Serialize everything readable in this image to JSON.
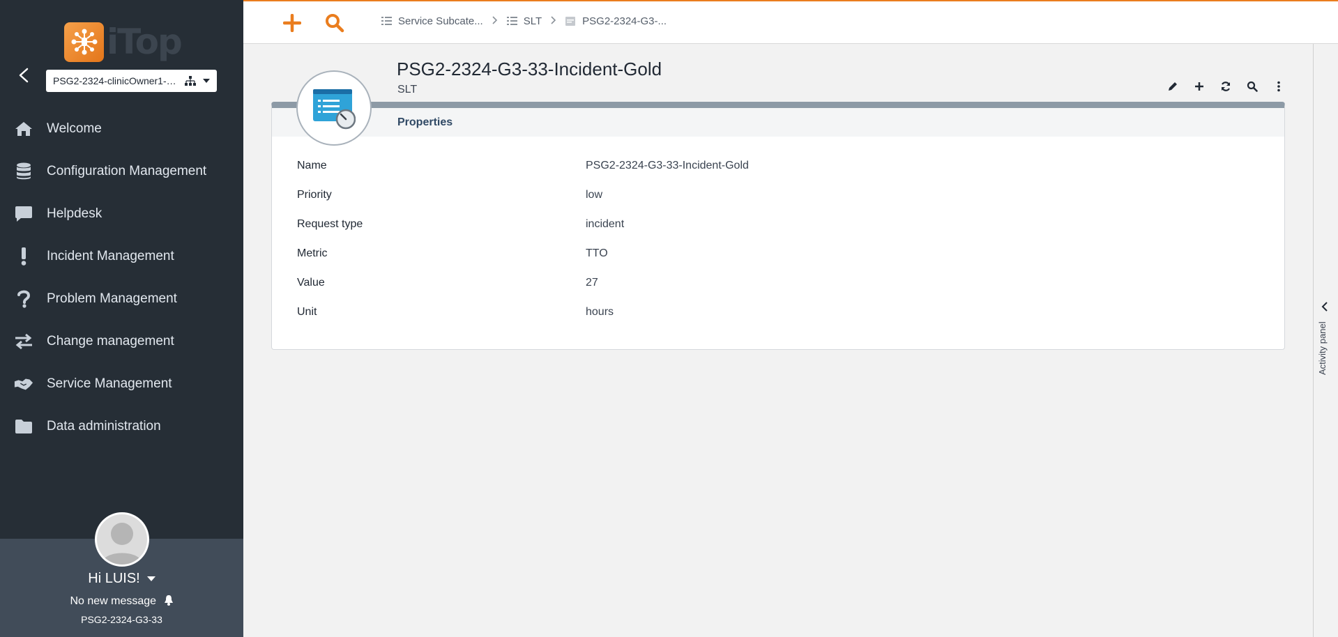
{
  "app": {
    "logo_text": "iTop",
    "org_selector": "PSG2-2324-clinicOwner1-G3..."
  },
  "sidebar": {
    "items": [
      {
        "label": "Welcome",
        "icon": "home-icon"
      },
      {
        "label": "Configuration Management",
        "icon": "database-icon"
      },
      {
        "label": "Helpdesk",
        "icon": "chat-icon"
      },
      {
        "label": "Incident Management",
        "icon": "exclamation-icon"
      },
      {
        "label": "Problem Management",
        "icon": "question-icon"
      },
      {
        "label": "Change management",
        "icon": "swap-icon"
      },
      {
        "label": "Service Management",
        "icon": "handshake-icon"
      },
      {
        "label": "Data administration",
        "icon": "folder-icon"
      }
    ]
  },
  "user": {
    "greeting": "Hi LUIS!",
    "messages": "No new message",
    "org": "PSG2-2324-G3-33"
  },
  "breadcrumb": {
    "items": [
      {
        "label": "Service Subcate..."
      },
      {
        "label": "SLT"
      },
      {
        "label": "PSG2-2324-G3-..."
      }
    ]
  },
  "object": {
    "title": "PSG2-2324-G3-33-Incident-Gold",
    "class": "SLT",
    "tab": "Properties",
    "properties": [
      {
        "label": "Name",
        "value": "PSG2-2324-G3-33-Incident-Gold"
      },
      {
        "label": "Priority",
        "value": "low"
      },
      {
        "label": "Request type",
        "value": "incident"
      },
      {
        "label": "Metric",
        "value": "TTO"
      },
      {
        "label": "Value",
        "value": "27"
      },
      {
        "label": "Unit",
        "value": "hours"
      }
    ]
  },
  "activity_panel": {
    "label": "Activity panel"
  },
  "colors": {
    "accent": "#ea7d1e",
    "sidebar": "#262e36",
    "user_panel": "#414c59"
  }
}
